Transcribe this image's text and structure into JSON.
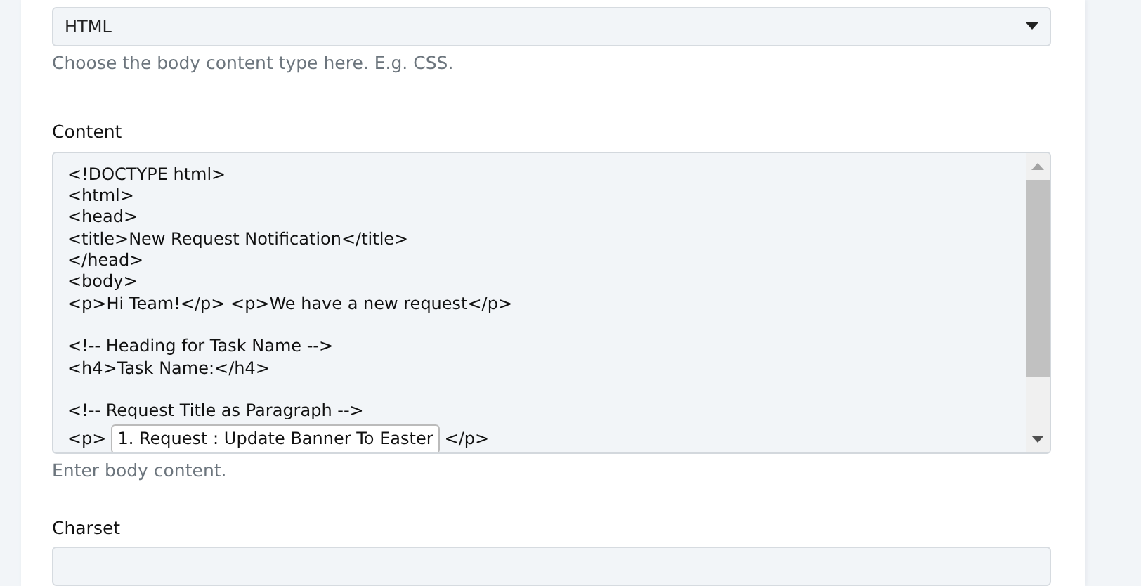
{
  "body_type": {
    "value": "HTML",
    "help": "Choose the body content type here. E.g. CSS."
  },
  "content": {
    "label": "Content",
    "help": "Enter body content.",
    "lines": [
      {
        "kind": "text",
        "text": "<!DOCTYPE html>"
      },
      {
        "kind": "text",
        "text": "<html>"
      },
      {
        "kind": "text",
        "text": "<head>"
      },
      {
        "kind": "text",
        "text": "<title>New Request Notification</title>"
      },
      {
        "kind": "text",
        "text": "</head>"
      },
      {
        "kind": "text",
        "text": "<body>"
      },
      {
        "kind": "text",
        "text": "<p>Hi Team!</p> <p>We have a new request</p>"
      },
      {
        "kind": "blank"
      },
      {
        "kind": "text",
        "text": "<!-- Heading for Task Name -->"
      },
      {
        "kind": "text",
        "text": "<h4>Task Name:</h4>"
      },
      {
        "kind": "blank"
      },
      {
        "kind": "text",
        "text": "<!-- Request Title as Paragraph -->"
      },
      {
        "kind": "field",
        "before": "<p>",
        "value": "1. Request : Update Banner To Easter",
        "after": "</p>"
      }
    ]
  },
  "charset": {
    "label": "Charset"
  }
}
